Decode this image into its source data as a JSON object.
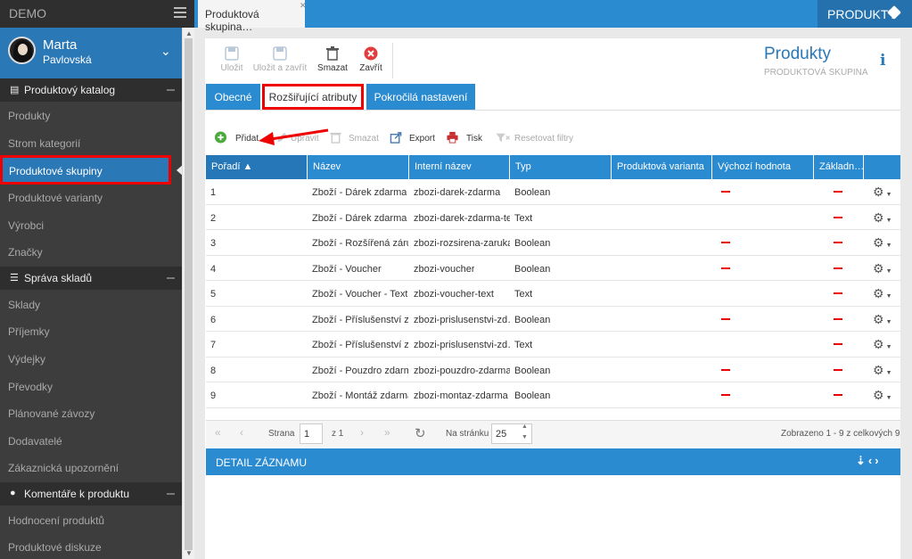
{
  "app": {
    "brand": "DEMO"
  },
  "user": {
    "first_name": "Marta",
    "last_name": "Pavlovská"
  },
  "sidebar": {
    "sections": [
      {
        "label": "Produktový katalog",
        "items": [
          "Produkty",
          "Strom kategorií",
          "Produktové skupiny",
          "Produktové varianty",
          "Výrobci",
          "Značky"
        ]
      },
      {
        "label": "Správa skladů",
        "items": [
          "Sklady",
          "Příjemky",
          "Výdejky",
          "Převodky",
          "Plánované závozy",
          "Dodavatelé",
          "Zákaznická upozornění"
        ]
      },
      {
        "label": "Komentáře k produktu",
        "items": [
          "Hodnocení produktů",
          "Produktové diskuze"
        ]
      }
    ]
  },
  "topbar": {
    "tab_label": "Produktová skupina…",
    "module_label": "PRODUKTY"
  },
  "toolbar": {
    "save": "Uložit",
    "save_close": "Uložit a zavřít",
    "delete": "Smazat",
    "close": "Zavřít"
  },
  "header": {
    "title": "Produkty",
    "subtitle": "PRODUKTOVÁ SKUPINA",
    "info": "i"
  },
  "tabs": [
    "Obecné",
    "Rozšiřující atributy",
    "Pokročilá nastavení"
  ],
  "actions": {
    "add": "Přidat",
    "edit": "Upravit",
    "delete": "Smazat",
    "export": "Export",
    "print": "Tisk",
    "reset": "Resetovat filtry"
  },
  "grid": {
    "columns": [
      "Pořadí ▲",
      "Název",
      "Interní název",
      "Typ",
      "Produktová varianta",
      "Výchozí hodnota",
      "Základn…"
    ],
    "rows": [
      {
        "order": "1",
        "name": "Zboží - Dárek zdarma",
        "internal": "zbozi-darek-zdarma",
        "type": "Boolean",
        "default_dash": true,
        "base_dash": true
      },
      {
        "order": "2",
        "name": "Zboží - Dárek zdarma …",
        "internal": "zbozi-darek-zdarma-te…",
        "type": "Text",
        "default_dash": false,
        "base_dash": true
      },
      {
        "order": "3",
        "name": "Zboží - Rozšířená záru…",
        "internal": "zbozi-rozsirena-zaruka",
        "type": "Boolean",
        "default_dash": true,
        "base_dash": true
      },
      {
        "order": "4",
        "name": "Zboží - Voucher",
        "internal": "zbozi-voucher",
        "type": "Boolean",
        "default_dash": true,
        "base_dash": true
      },
      {
        "order": "5",
        "name": "Zboží - Voucher - Text",
        "internal": "zbozi-voucher-text",
        "type": "Text",
        "default_dash": false,
        "base_dash": true
      },
      {
        "order": "6",
        "name": "Zboží - Příslušenství z…",
        "internal": "zbozi-prislusenstvi-zd…",
        "type": "Boolean",
        "default_dash": true,
        "base_dash": true
      },
      {
        "order": "7",
        "name": "Zboží - Příslušenství z…",
        "internal": "zbozi-prislusenstvi-zd…",
        "type": "Text",
        "default_dash": false,
        "base_dash": true
      },
      {
        "order": "8",
        "name": "Zboží - Pouzdro zdarma",
        "internal": "zbozi-pouzdro-zdarma",
        "type": "Boolean",
        "default_dash": true,
        "base_dash": true
      },
      {
        "order": "9",
        "name": "Zboží - Montáž zdarma",
        "internal": "zbozi-montaz-zdarma",
        "type": "Boolean",
        "default_dash": true,
        "base_dash": true
      }
    ]
  },
  "pager": {
    "page_label": "Strana",
    "page_value": "1",
    "of_label": "z 1",
    "per_page_label": "Na stránku",
    "per_page_value": "25",
    "summary": "Zobrazeno 1 - 9 z celkových 9"
  },
  "detail": {
    "title": "DETAIL ZÁZNAMU"
  },
  "colors": {
    "accent": "#2b8bd0",
    "sidebar": "#3d3d3d",
    "highlight": "#ee0000"
  }
}
